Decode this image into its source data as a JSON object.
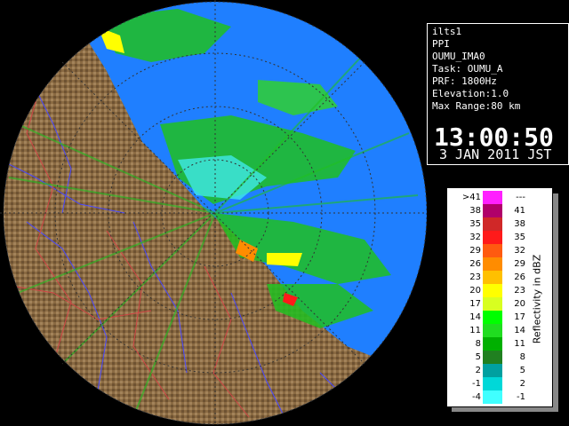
{
  "info": {
    "lines": [
      "ilts1",
      "PPI",
      "OUMU_IMA0",
      "Task: OUMU_A",
      "PRF: 1800Hz",
      "Elevation:1.0",
      "Max Range:80 km"
    ],
    "time": "13:00:50",
    "date": "3 JAN 2011 JST"
  },
  "legend": {
    "unit": "Reflectivity in dBZ",
    "rows": [
      {
        "lo": ">41",
        "hi": "---",
        "color": "#ff20ff"
      },
      {
        "lo": "38",
        "hi": "41",
        "color": "#b0006a"
      },
      {
        "lo": "35",
        "hi": "38",
        "color": "#d02828"
      },
      {
        "lo": "32",
        "hi": "35",
        "color": "#ff1a1a"
      },
      {
        "lo": "29",
        "hi": "32",
        "color": "#ff5a10"
      },
      {
        "lo": "26",
        "hi": "29",
        "color": "#ff8c00"
      },
      {
        "lo": "23",
        "hi": "26",
        "color": "#ffc000"
      },
      {
        "lo": "20",
        "hi": "23",
        "color": "#ffff00"
      },
      {
        "lo": "17",
        "hi": "20",
        "color": "#d8ff20"
      },
      {
        "lo": "14",
        "hi": "17",
        "color": "#00ff00"
      },
      {
        "lo": "11",
        "hi": "14",
        "color": "#20dd20"
      },
      {
        "lo": "8",
        "hi": "11",
        "color": "#00b000"
      },
      {
        "lo": "5",
        "hi": "8",
        "color": "#208020"
      },
      {
        "lo": "2",
        "hi": "5",
        "color": "#00a0a0"
      },
      {
        "lo": "-1",
        "hi": "2",
        "color": "#00d8d8"
      },
      {
        "lo": "-4",
        "hi": "-1",
        "color": "#40ffff"
      }
    ]
  },
  "colors": {
    "radar_background": "#1f7fff",
    "land": "#8a6a42",
    "river": "#4040ff",
    "border": "#cc4040"
  }
}
